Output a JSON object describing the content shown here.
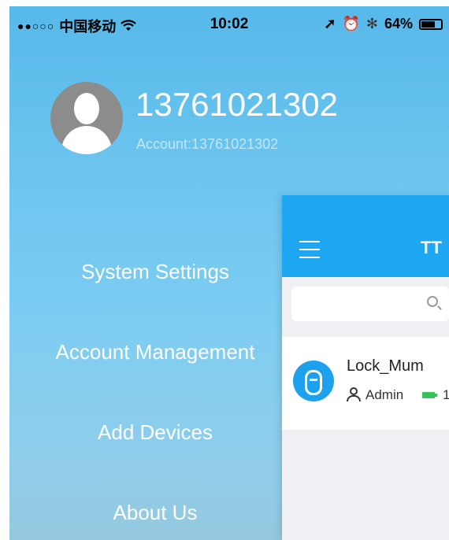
{
  "status_bar": {
    "signal": "●●○○○",
    "carrier": "中国移动",
    "wifi": "wifi-icon",
    "time": "10:02",
    "location": "➚",
    "alarm": "⏰",
    "bluetooth": "✻",
    "battery_percent": "64%",
    "battery_level": 0.64
  },
  "profile": {
    "phone": "13761021302",
    "account": "Account:13761021302",
    "avatar_icon": "avatar-icon"
  },
  "menu": {
    "items": [
      {
        "label": "System Settings"
      },
      {
        "label": "Account Management"
      },
      {
        "label": "Add Devices"
      },
      {
        "label": "About Us"
      }
    ]
  },
  "panel": {
    "title": "TT",
    "search_icon": "search-icon",
    "accent": "#1ea7f2",
    "device": {
      "name": "Lock_Mum",
      "role": "Admin",
      "battery": "1"
    }
  }
}
